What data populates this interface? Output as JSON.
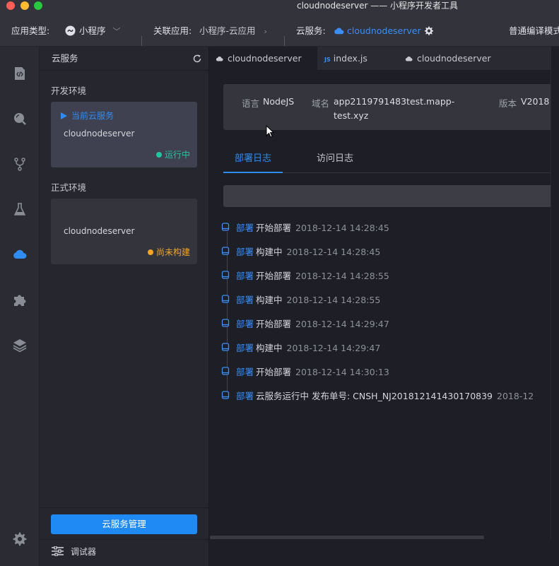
{
  "window": {
    "title": "cloudnodeserver —— 小程序开发者工具"
  },
  "toolbar": {
    "app_type_label": "应用类型:",
    "app_type_value": "小程序",
    "linked_app_label": "关联应用:",
    "linked_app_value": "小程序-云应用",
    "cloud_service_label": "云服务:",
    "cloud_service_value": "cloudnodeserver",
    "compile_mode": "普通编译模式"
  },
  "activity_bar": {
    "icons": [
      "code-icon",
      "search-icon",
      "branch-icon",
      "flask-icon",
      "cloud-icon",
      "puzzle-icon",
      "layers-icon",
      "settings-icon"
    ]
  },
  "panel": {
    "title": "云服务",
    "dev_env_label": "开发环境",
    "dev_card": {
      "current_label": "当前云服务",
      "name": "cloudnodeserver",
      "status": "运行中",
      "status_color": "#23c4a0"
    },
    "prod_env_label": "正式环境",
    "prod_card": {
      "name": "cloudnodeserver",
      "status": "尚未构建",
      "status_color": "#f5a623"
    },
    "manage_button": "云服务管理",
    "debug_label": "调试器"
  },
  "editor_tabs": [
    {
      "label": "cloudnodeserver",
      "icon": "cloud-icon",
      "active": true
    },
    {
      "label": "index.js",
      "icon": "js-icon",
      "active": false
    },
    {
      "label": "cloudnodeserver",
      "icon": "cloud-icon",
      "active": false
    }
  ],
  "info": {
    "language_key": "语言",
    "language_value": "NodeJS",
    "domain_key": "域名",
    "domain_value_1": "app2119791483test.mapp-",
    "domain_value_2": "test.xyz",
    "version_key": "版本",
    "version_value": "V2018"
  },
  "subtabs": {
    "deploy_log": "部署日志",
    "access_log": "访问日志"
  },
  "logs": [
    {
      "tag": "部署",
      "message": "开始部署",
      "time": "2018-12-14 14:28:45"
    },
    {
      "tag": "部署",
      "message": "构建中",
      "time": "2018-12-14 14:28:45"
    },
    {
      "tag": "部署",
      "message": "开始部署",
      "time": "2018-12-14 14:28:55"
    },
    {
      "tag": "部署",
      "message": "构建中",
      "time": "2018-12-14 14:28:55"
    },
    {
      "tag": "部署",
      "message": "开始部署",
      "time": "2018-12-14 14:29:47"
    },
    {
      "tag": "部署",
      "message": "构建中",
      "time": "2018-12-14 14:29:47"
    },
    {
      "tag": "部署",
      "message": "开始部署",
      "time": "2018-12-14 14:30:13"
    },
    {
      "tag": "部署",
      "message": "云服务运行中 发布单号:  CNSH_NJ201812141430170839",
      "time": "2018-12"
    }
  ],
  "colors": {
    "accent": "#2f8cf1",
    "running": "#23c4a0",
    "not_built": "#f5a623"
  }
}
